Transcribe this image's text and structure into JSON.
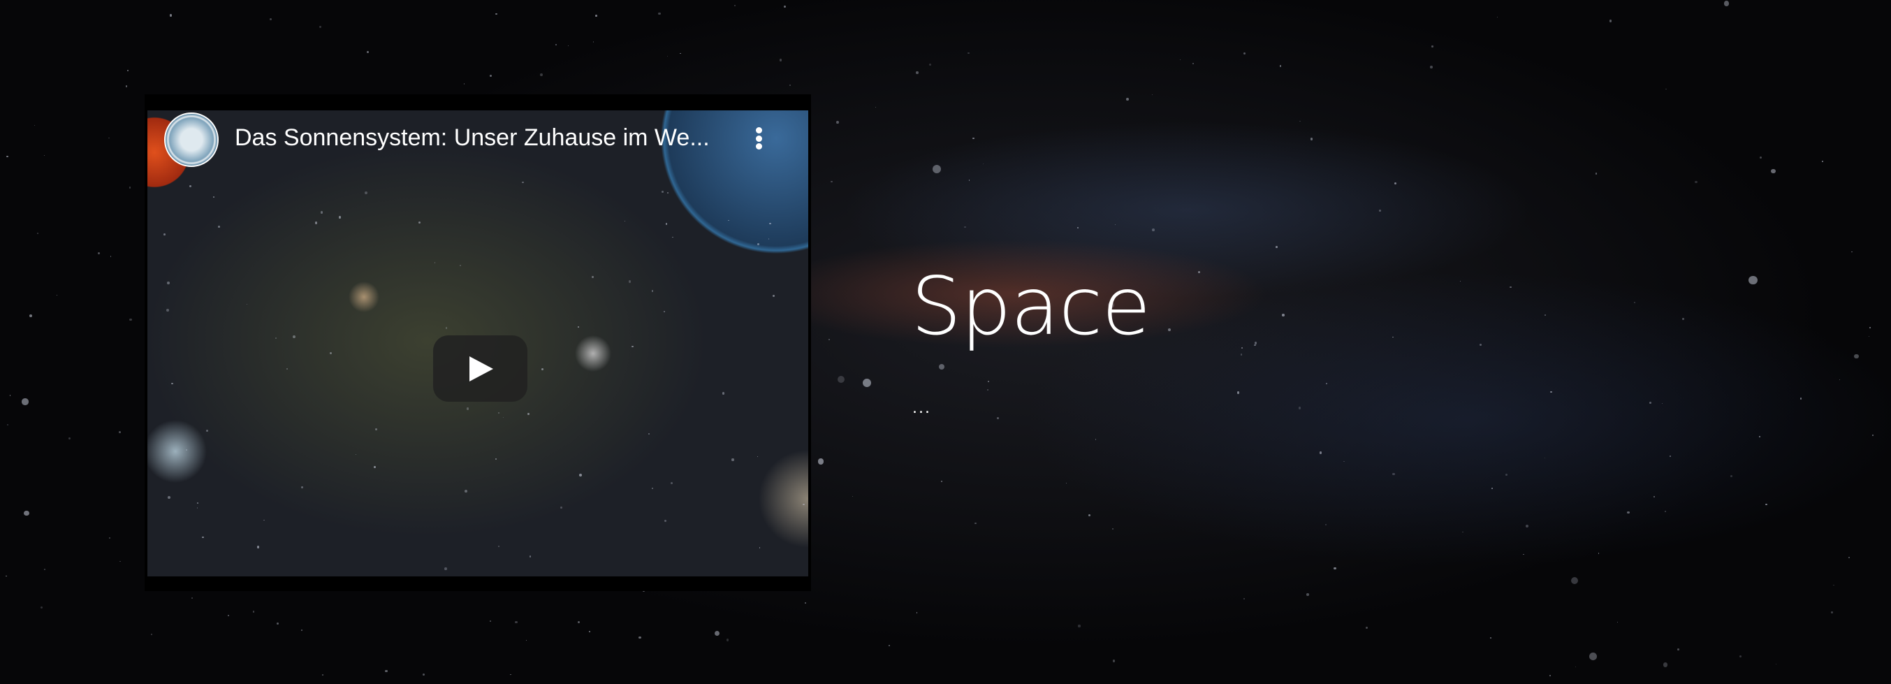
{
  "video": {
    "title": "Das Sonnensystem: Unser Zuhause im We...",
    "channel_avatar": "university-seal",
    "menu_icon": "more-vertical-icon",
    "play_icon": "play-icon"
  },
  "section": {
    "title": "Space",
    "subtitle": "..."
  }
}
